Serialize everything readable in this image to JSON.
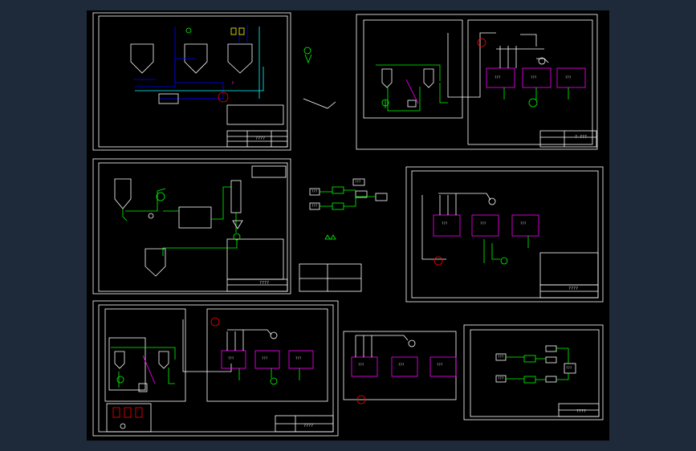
{
  "colors": {
    "background": "#000000",
    "app_frame": "#1e2a3a",
    "frame": "#ffffff",
    "equipment": "#ff00ff",
    "pipe_primary": "#00ff00",
    "pipe_secondary": "#0000ff",
    "pipe_tertiary": "#00ffff",
    "valve": "#ffff00",
    "accent_red": "#ff0000"
  },
  "drawing_sheets": [
    {
      "name": "sheet-tank-farm",
      "title_text": "????"
    },
    {
      "name": "sheet-spray-dryer-upper",
      "title_text": "?-???"
    },
    {
      "name": "sheet-ball-mill",
      "title_text": "????"
    },
    {
      "name": "sheet-kiln-line",
      "title_text": "????"
    },
    {
      "name": "sheet-combined-line",
      "title_text": "????"
    },
    {
      "name": "sheet-block-diagram",
      "title_text": "????"
    }
  ],
  "equipment_labels": {
    "upper_right_units": [
      "???",
      "???",
      "???"
    ],
    "mid_right_units": [
      "???",
      "???",
      "???"
    ],
    "lower_left_units": [
      "???",
      "???",
      "???"
    ],
    "lower_center_units": [
      "???",
      "???",
      "???"
    ]
  },
  "flow_block_labels": [
    "???",
    "???",
    "???",
    "???",
    "???",
    "???"
  ]
}
